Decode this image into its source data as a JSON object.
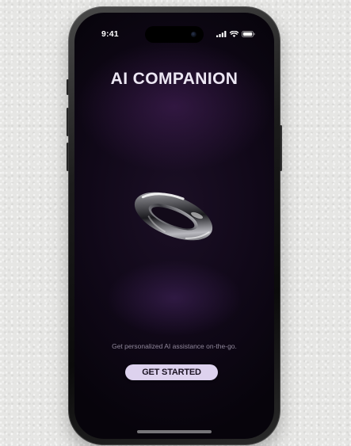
{
  "colors": {
    "page_background": "#e6e6e4",
    "screen_background": "#100818",
    "title_text": "#ece7f3",
    "tagline_text": "#8f879a",
    "button_background": "#ddd2ee",
    "button_text": "#1a1222"
  },
  "status_bar": {
    "time": "9:41",
    "icons": [
      "signal-icon",
      "wifi-icon",
      "battery-icon"
    ]
  },
  "screen": {
    "title": "AI COMPANION",
    "hero_image": "glass-ring-icon",
    "tagline": "Get personalized AI assistance on-the-go.",
    "cta_label": "GET STARTED"
  }
}
